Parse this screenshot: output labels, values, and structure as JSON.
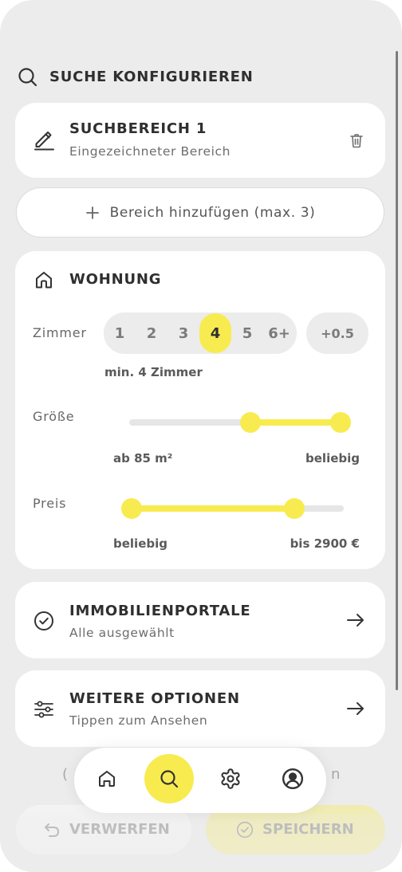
{
  "header": {
    "title": "SUCHE KONFIGURIEREN",
    "icon": "search-icon"
  },
  "search_area": {
    "title": "SUCHBEREICH 1",
    "subtitle": "Eingezeichneter Bereich",
    "icon": "pencil-icon",
    "delete_icon": "trash-icon"
  },
  "add_area": {
    "label": "Bereich hinzufügen (max. 3)",
    "icon": "plus-icon"
  },
  "apartment": {
    "title": "WOHNUNG",
    "icon": "house-icon",
    "rooms": {
      "label": "Zimmer",
      "options": [
        "1",
        "2",
        "3",
        "4",
        "5",
        "6+"
      ],
      "selected_index": 3,
      "half_step": "+0.5",
      "hint": "min. 4 Zimmer"
    },
    "size": {
      "label": "Größe",
      "min_label": "ab 85 m²",
      "max_label": "beliebig",
      "range": [
        0.57,
        1.0
      ]
    },
    "price": {
      "label": "Preis",
      "min_label": "beliebig",
      "max_label": "bis 2900 €",
      "range": [
        0.0,
        0.78
      ]
    }
  },
  "portals": {
    "title": "IMMOBILIENPORTALE",
    "subtitle": "Alle ausgewählt",
    "icon": "check-circle-icon",
    "action_icon": "arrow-right-icon"
  },
  "more_options": {
    "title": "WEITERE OPTIONEN",
    "subtitle": "Tippen zum Ansehen",
    "icon": "sliders-icon",
    "action_icon": "arrow-right-icon"
  },
  "hidden_row": {
    "left_fragment": "(",
    "right_fragment": "n"
  },
  "actions": {
    "discard_label": "VERWERFEN",
    "discard_icon": "undo-icon",
    "save_label": "SPEICHERN",
    "save_icon": "check-circle-icon"
  },
  "nav": {
    "items": [
      {
        "icon": "home-icon",
        "active": false
      },
      {
        "icon": "search-icon",
        "active": true
      },
      {
        "icon": "gear-icon",
        "active": false
      },
      {
        "icon": "user-circle-icon",
        "active": false
      }
    ]
  },
  "colors": {
    "background": "#ececec",
    "card": "#ffffff",
    "accent": "#f8eb4f",
    "text": "#2f2f2f",
    "muted": "#6d6d6d",
    "track": "#e6e6e6"
  }
}
